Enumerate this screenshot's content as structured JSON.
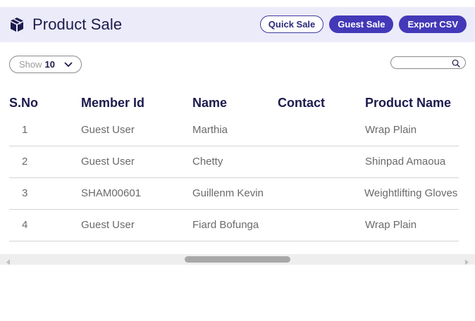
{
  "header": {
    "title": "Product Sale",
    "icon": "box-icon",
    "buttons": {
      "quick_sale": "Quick Sale",
      "guest_sale": "Guest Sale",
      "export_csv": "Export CSV"
    }
  },
  "controls": {
    "show_label": "Show",
    "show_value": "10",
    "search_placeholder": ""
  },
  "table": {
    "columns": [
      "S.No",
      "Member Id",
      "Name",
      "Contact",
      "Product Name"
    ],
    "rows": [
      {
        "sno": "1",
        "member_id": "Guest User",
        "name": "Marthia",
        "contact": "",
        "product": "Wrap Plain"
      },
      {
        "sno": "2",
        "member_id": "Guest User",
        "name": "Chetty",
        "contact": "",
        "product": "Shinpad Amaoua"
      },
      {
        "sno": "3",
        "member_id": "SHAM00601",
        "name": "Guillenm Kevin",
        "contact": "",
        "product": "Weightlifting Gloves"
      },
      {
        "sno": "4",
        "member_id": "Guest User",
        "name": "Fiard Bofunga",
        "contact": "",
        "product": "Wrap Plain"
      }
    ]
  },
  "colors": {
    "header_bg": "#ecebfa",
    "accent": "#4339b8",
    "heading_text": "#1c1b4d"
  }
}
